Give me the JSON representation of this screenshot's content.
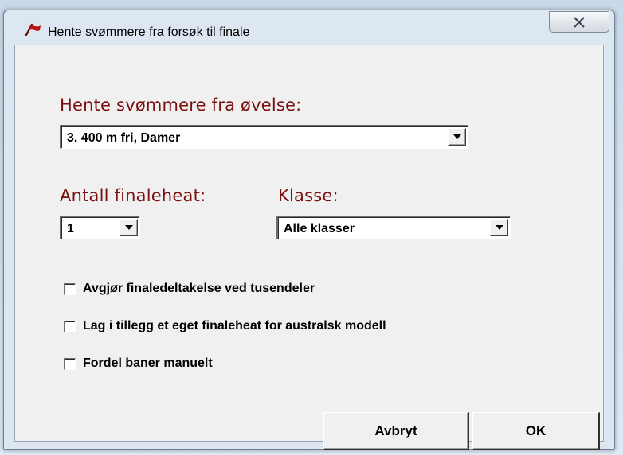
{
  "window": {
    "title": "Hente svømmere fra forsøk til finale"
  },
  "event_section": {
    "label": "Hente svømmere fra øvelse:",
    "selected": "3. 400 m fri, Damer"
  },
  "heat_section": {
    "label": "Antall finaleheat:",
    "selected": "1"
  },
  "class_section": {
    "label": "Klasse:",
    "selected": "Alle klasser"
  },
  "options": [
    {
      "label": "Avgjør finaledeltakelse ved tusendeler",
      "checked": false
    },
    {
      "label": "Lag i tillegg et eget finaleheat for australsk modell",
      "checked": false
    },
    {
      "label": "Fordel baner manuelt",
      "checked": false
    }
  ],
  "buttons": {
    "cancel": "Avbryt",
    "ok": "OK"
  },
  "colors": {
    "label_red": "#7a1010",
    "dialog_face": "#f0f0f0",
    "frame": "#dce7f2"
  },
  "icons": {
    "app": "flag-icon",
    "close": "close-icon"
  }
}
